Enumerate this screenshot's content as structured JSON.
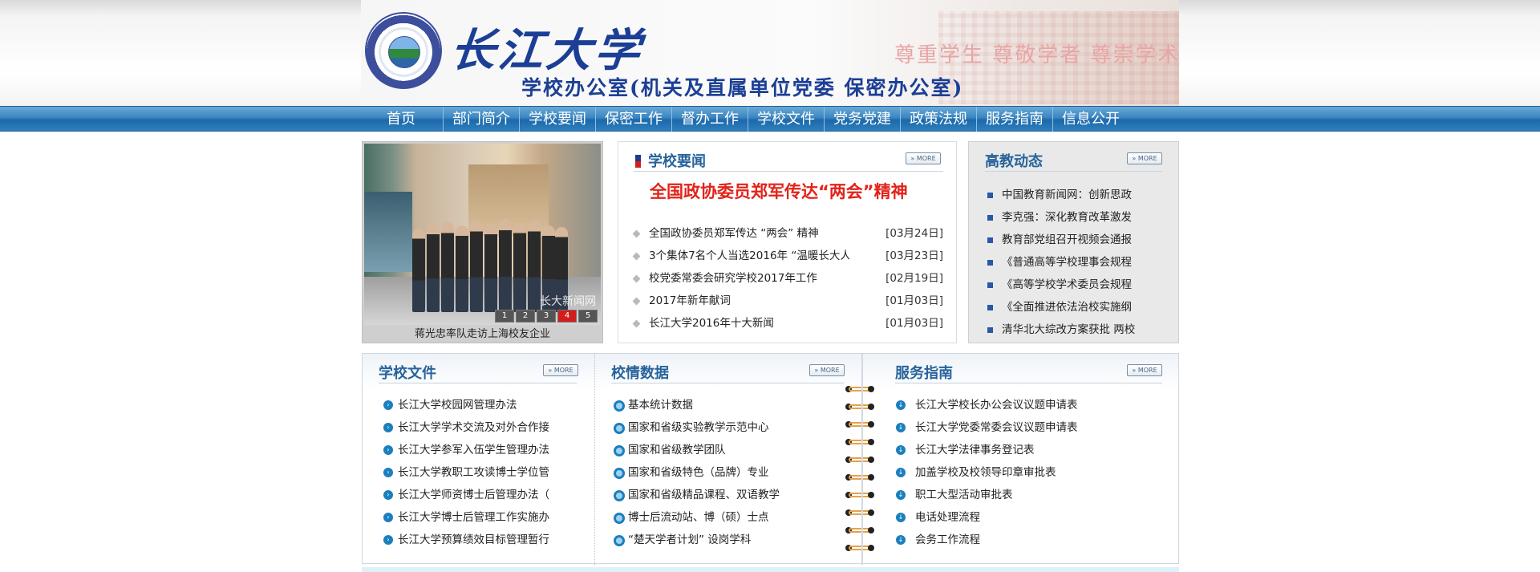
{
  "header": {
    "seal_text": "YANGTZE UNIVERSITY",
    "logo_text": "长江大学",
    "office_title": "学校办公室(机关及直属单位党委  保密办公室)",
    "motto": "尊重学生 尊敬学者 尊崇学术"
  },
  "nav": {
    "items": [
      "首页",
      "部门简介",
      "学校要闻",
      "保密工作",
      "督办工作",
      "学校文件",
      "党务党建",
      "政策法规",
      "服务指南",
      "信息公开"
    ]
  },
  "slideshow": {
    "watermark": "长大新闻网",
    "numbers": [
      "1",
      "2",
      "3",
      "4",
      "5"
    ],
    "active_index": 4,
    "caption": "蒋光忠率队走访上海校友企业"
  },
  "school_news": {
    "title": "学校要闻",
    "more_label": "» MORE",
    "headline": "全国政协委员郑军传达“两会”精神",
    "items": [
      {
        "text": "全国政协委员郑军传达 “两会” 精神",
        "date": "[03月24日]"
      },
      {
        "text": "3个集体7名个人当选2016年 “温暖长大人",
        "date": "[03月23日]"
      },
      {
        "text": "校党委常委会研究学校2017年工作",
        "date": "[02月19日]"
      },
      {
        "text": "2017年新年献词",
        "date": "[01月03日]"
      },
      {
        "text": "长江大学2016年十大新闻",
        "date": "[01月03日]"
      }
    ]
  },
  "higher_ed": {
    "title": "高教动态",
    "more_label": "» MORE",
    "items": [
      "中国教育新闻网：创新思政",
      "李克强：深化教育改革激发",
      "教育部党组召开视频会通报",
      "《普通高等学校理事会规程",
      "《高等学校学术委员会规程",
      "《全面推进依法治校实施纲",
      "清华北大综改方案获批 两校"
    ]
  },
  "school_docs": {
    "title": "学校文件",
    "more_label": "» MORE",
    "items": [
      "长江大学校园网管理办法",
      "长江大学学术交流及对外合作接",
      "长江大学参军入伍学生管理办法",
      "长江大学教职工攻读博士学位管",
      "长江大学师资博士后管理办法（",
      "长江大学博士后管理工作实施办",
      "长江大学预算绩效目标管理暂行"
    ]
  },
  "school_data": {
    "title": "校情数据",
    "more_label": "» MORE",
    "items": [
      "基本统计数据",
      "国家和省级实验教学示范中心",
      "国家和省级教学团队",
      "国家和省级特色（品牌）专业",
      "国家和省级精品课程、双语教学",
      "博士后流动站、博（硕）士点",
      "“楚天学者计划” 设岗学科"
    ]
  },
  "service_guide": {
    "title": "服务指南",
    "more_label": "» MORE",
    "items": [
      "长江大学校长办公会议议题申请表",
      "长江大学党委常委会议议题申请表",
      "长江大学法律事务登记表",
      "加盖学校及校领导印章审批表",
      "职工大型活动审批表",
      "电话处理流程",
      "会务工作流程"
    ]
  },
  "colors": {
    "nav_blue": "#2f7fbd",
    "title_blue": "#27639b",
    "headline_red": "#e2231a",
    "brand_blue": "#1b3f95"
  }
}
